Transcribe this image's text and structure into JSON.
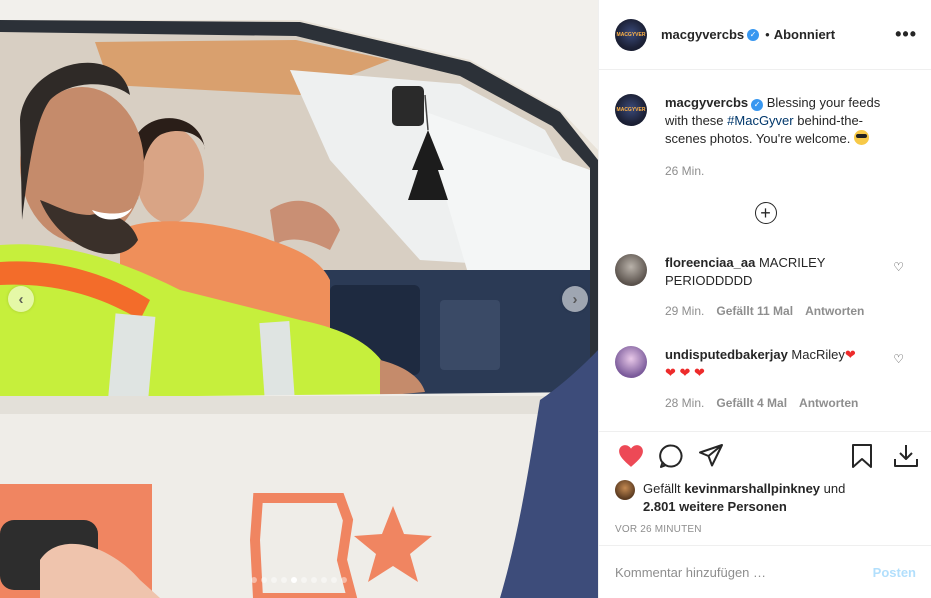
{
  "post": {
    "username": "macgyvercbs",
    "follow_sep": "•",
    "follow_label": "Abonniert",
    "more_label": "•••",
    "avatar_text": "MACGYVER"
  },
  "caption": {
    "username": "macgyvercbs",
    "text_before": " Blessing your feeds with these ",
    "hashtag": "#MacGyver",
    "text_after": " behind-the-scenes photos. You're welcome. ",
    "time": "26 Min."
  },
  "load_more_label": "+",
  "comments": [
    {
      "username": "floreenciaa_aa",
      "text": " MACRILEY PERIODDDDD",
      "time": "29 Min.",
      "likes": "Gefällt 11 Mal",
      "reply": "Antworten"
    },
    {
      "username": "undisputedbakerjay",
      "text": " MacRiley",
      "emoji_line": "❤ ❤ ❤",
      "time": "28 Min.",
      "likes": "Gefällt 4 Mal",
      "reply": "Antworten"
    }
  ],
  "likes": {
    "prefix": "Gefällt ",
    "user": "kevinmarshallpinkney",
    "middle": " und ",
    "count": "2.801 weitere Personen"
  },
  "timestamp": "VOR 26 MINUTEN",
  "comment_box": {
    "placeholder": "Kommentar hinzufügen …",
    "post_label": "Posten"
  },
  "carousel": {
    "total": 10,
    "active_index": 4,
    "prev": "‹",
    "next": "›"
  },
  "colors": {
    "like_red": "#ed4956",
    "verified_blue": "#3897f0",
    "post_button": "#b2dffc"
  }
}
